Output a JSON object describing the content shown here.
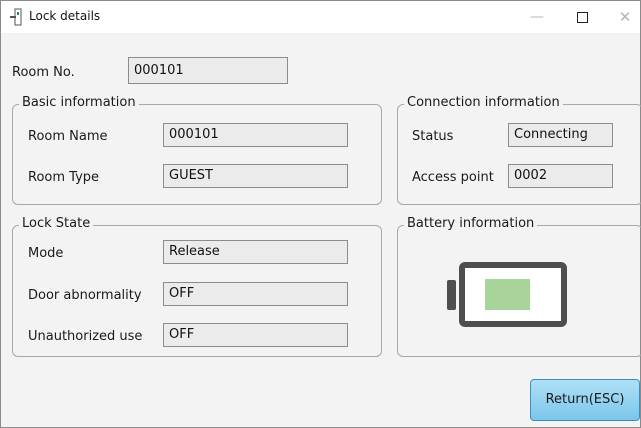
{
  "window": {
    "title": "Lock details",
    "controls": {
      "minimize": "—",
      "close": "✕"
    }
  },
  "room": {
    "label": "Room No.",
    "value": "000101"
  },
  "basic_info": {
    "title": "Basic information",
    "room_name": {
      "label": "Room Name",
      "value": "000101"
    },
    "room_type": {
      "label": "Room Type",
      "value": "GUEST"
    }
  },
  "connection_info": {
    "title": "Connection information",
    "status": {
      "label": "Status",
      "value": "Connecting"
    },
    "access_point": {
      "label": "Access point",
      "value": "0002"
    }
  },
  "lock_state": {
    "title": "Lock State",
    "mode": {
      "label": "Mode",
      "value": "Release"
    },
    "door_abnormality": {
      "label": "Door abnormality",
      "value": "OFF"
    },
    "unauthorized_use": {
      "label": "Unauthorized use",
      "value": "OFF"
    }
  },
  "battery_info": {
    "title": "Battery information",
    "fill_color": "#a8d49c",
    "icon": "battery-icon"
  },
  "buttons": {
    "return_label": "Return(ESC)"
  },
  "colors": {
    "button_top": "#aee0f7",
    "button_bottom": "#7cc6ea",
    "button_border": "#3c8fbd"
  }
}
